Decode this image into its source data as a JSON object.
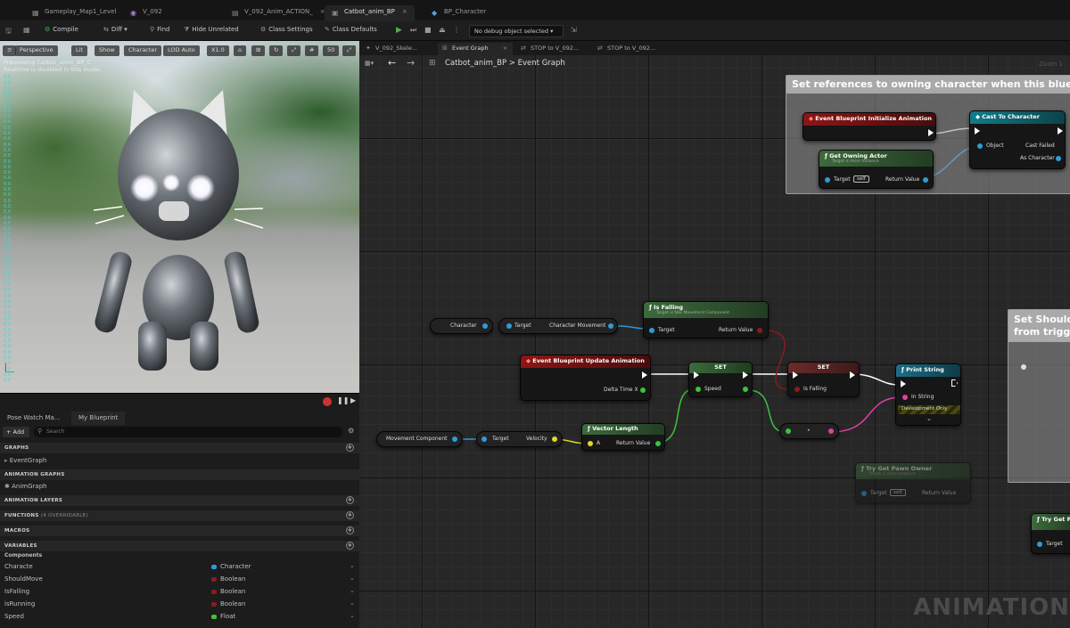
{
  "tabs": [
    {
      "label": "Gameplay_Map1_Level",
      "icon": "level-icon"
    },
    {
      "label": "V_092",
      "icon": "blueprint-icon"
    },
    {
      "label": "V_092_Anim_ACTION_",
      "icon": "anim-icon"
    },
    {
      "label": "Catbot_anim_BP",
      "icon": "anim-bp-icon"
    },
    {
      "label": "BP_Character",
      "icon": "blueprint-icon"
    }
  ],
  "toolbar": {
    "compile": "Compile",
    "diff": "Diff",
    "find": "Find",
    "hide_unrelated": "Hide Unrelated",
    "class_settings": "Class Settings",
    "class_defaults": "Class Defaults",
    "debug_select": "No debug object selected"
  },
  "viewport": {
    "buttons": [
      "Perspective",
      "Lit",
      "Show",
      "Character",
      "LOD Auto",
      "X1.0",
      "50"
    ],
    "message_line1": "Previewing Catbot_anim_BP_C.",
    "message_line2": "Realtime is disabled in this mode.",
    "stats": [
      "0.0",
      "0.0",
      "0.0",
      "0.0",
      "0.0",
      "0.0",
      "0.0",
      "0.0",
      "0.0",
      "0.0",
      "0.0",
      "0.0",
      "0.0",
      "0.0",
      "0.0",
      "0.0",
      "0.0",
      "0.0",
      "0.0",
      "0.0",
      "0.0",
      "0.0",
      "0.0",
      "0.0",
      "0.0",
      "0.0",
      "0.0",
      "0.0",
      "0.0",
      "0.0",
      "0.0",
      "0.0",
      "0.0",
      "0.0",
      "0.0",
      "0.0",
      "0.0",
      "0.0",
      "0.0",
      "0.0",
      "0.0",
      "0.0",
      "0.0",
      "0.0",
      "0.0",
      "0.0",
      "0.0",
      "0.0",
      "0.0",
      "0.0",
      "0.0",
      "0.0",
      "0.0",
      "0.0",
      "0.0"
    ]
  },
  "panel": {
    "tabs": [
      "Pose Watch Ma...",
      "My Blueprint"
    ],
    "add": "+ Add",
    "search_placeholder": "Search",
    "sections": {
      "graphs": "GRAPHS",
      "anim_graphs": "ANIMATION GRAPHS",
      "anim_layers": "ANIMATION LAYERS",
      "functions": "FUNCTIONS",
      "functions_note": "(4 OVERRIDABLE)",
      "macros": "MACROS",
      "variables": "VARIABLES",
      "components": "Components"
    },
    "event_graph": "EventGraph",
    "anim_graph": "AnimGraph",
    "variables": [
      {
        "name": "Characte",
        "type": "Character",
        "color": "#2e9cd6"
      },
      {
        "name": "ShouldMove",
        "type": "Boolean",
        "color": "#8a1c1c"
      },
      {
        "name": "IsFalling",
        "type": "Boolean",
        "color": "#8a1c1c"
      },
      {
        "name": "isRunning",
        "type": "Boolean",
        "color": "#8a1c1c"
      },
      {
        "name": "Speed",
        "type": "Float",
        "color": "#3cc23c"
      }
    ]
  },
  "graph": {
    "tabs": [
      "V_092_Skele...",
      "Event Graph",
      "STOP to V_092...",
      "STOP to V_092..."
    ],
    "breadcrumb_root": "Catbot_anim_BP",
    "breadcrumb_sep": ">",
    "breadcrumb_leaf": "Event Graph",
    "zoom": "Zoom 1",
    "comment1": "Set references to owning character when this blueprint",
    "comment2_line1": "Set Should",
    "comment2_line2": "from trigger",
    "nodes": {
      "init_title": "Event Blueprint Initialize Animation",
      "cast_title": "Cast To Character",
      "cast_object": "Object",
      "cast_failed": "Cast Failed",
      "cast_as": "As Character",
      "owning_title": "Get Owning Actor",
      "owning_sub": "Target is Anim Instance",
      "target": "Target",
      "self": "self",
      "return_value": "Return Value",
      "character_var": "Character",
      "char_movement": "Character Movement",
      "isfalling_title": "Is Falling",
      "isfalling_sub": "Target is Nav Movement Component",
      "update_title": "Event Blueprint Update Animation",
      "delta": "Delta Time X",
      "set": "SET",
      "speed": "Speed",
      "is_falling": "Is Falling",
      "print_title": "Print String",
      "in_string": "In String",
      "dev_only": "Development Only",
      "movement_component": "Movement Component",
      "velocity": "Velocity",
      "vlen_title": "Vector Length",
      "a": "A",
      "ghost_title": "Try Get Pawn Owner",
      "ghost_sub": "Target is Anim Instance",
      "edge_title": "Try Get P"
    },
    "watermark": "ANIMATION"
  }
}
